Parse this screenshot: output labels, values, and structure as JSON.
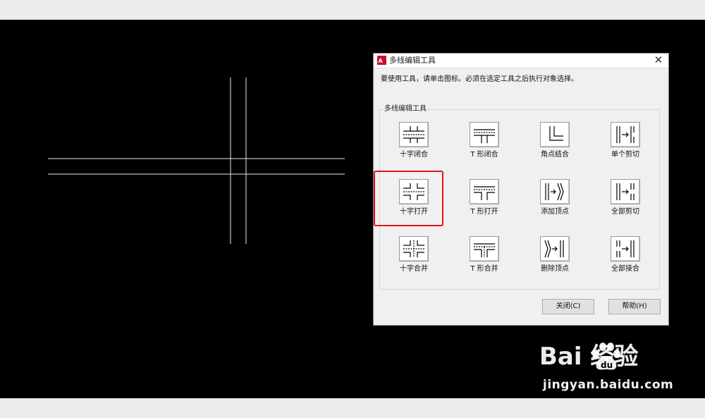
{
  "dialog": {
    "title": "多线编辑工具",
    "instruction": "要使用工具，请单击图标。必须在选定工具之后执行对象选择。",
    "group_title": "多线编辑工具",
    "tools": [
      {
        "label": "十字闭合",
        "icon": "closed-cross-icon"
      },
      {
        "label": "T 形闭合",
        "icon": "closed-tee-icon"
      },
      {
        "label": "角点结合",
        "icon": "corner-joint-icon"
      },
      {
        "label": "单个剪切",
        "icon": "cut-single-icon"
      },
      {
        "label": "十字打开",
        "icon": "open-cross-icon"
      },
      {
        "label": "T 形打开",
        "icon": "open-tee-icon"
      },
      {
        "label": "添加顶点",
        "icon": "add-vertex-icon"
      },
      {
        "label": "全部剪切",
        "icon": "cut-all-icon"
      },
      {
        "label": "十字合并",
        "icon": "merged-cross-icon"
      },
      {
        "label": "T 形合并",
        "icon": "merged-tee-icon"
      },
      {
        "label": "删除顶点",
        "icon": "delete-vertex-icon"
      },
      {
        "label": "全部接合",
        "icon": "weld-all-icon"
      }
    ],
    "close_button": "关闭(C)",
    "help_button": "帮助(H)"
  },
  "highlight_color": "#e0161b",
  "watermark": {
    "logo": "Bai  经验",
    "url": "jingyan.baidu.com"
  }
}
